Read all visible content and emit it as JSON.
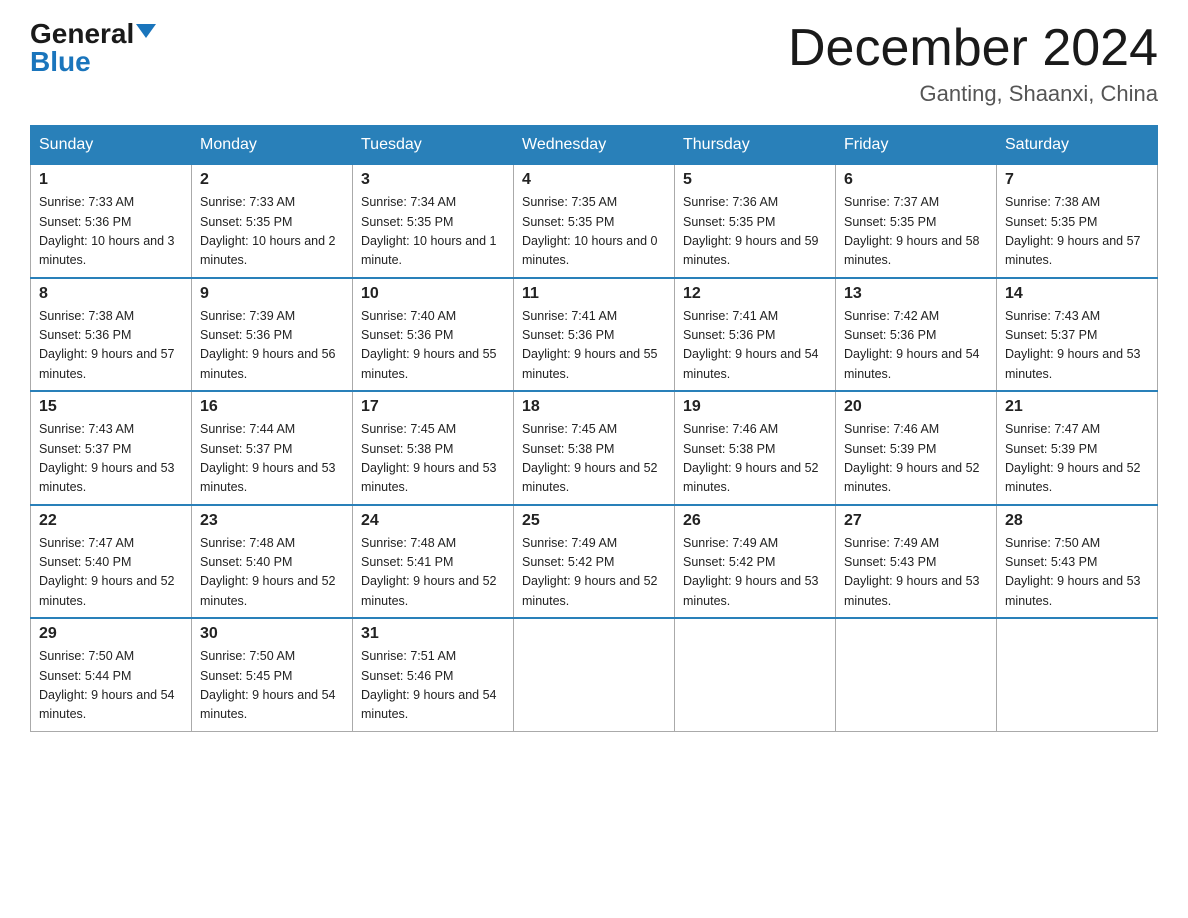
{
  "header": {
    "logo_general": "General",
    "logo_blue": "Blue",
    "month_title": "December 2024",
    "location": "Ganting, Shaanxi, China"
  },
  "days_of_week": [
    "Sunday",
    "Monday",
    "Tuesday",
    "Wednesday",
    "Thursday",
    "Friday",
    "Saturday"
  ],
  "weeks": [
    [
      {
        "day": "1",
        "sunrise": "7:33 AM",
        "sunset": "5:36 PM",
        "daylight": "10 hours and 3 minutes."
      },
      {
        "day": "2",
        "sunrise": "7:33 AM",
        "sunset": "5:35 PM",
        "daylight": "10 hours and 2 minutes."
      },
      {
        "day": "3",
        "sunrise": "7:34 AM",
        "sunset": "5:35 PM",
        "daylight": "10 hours and 1 minute."
      },
      {
        "day": "4",
        "sunrise": "7:35 AM",
        "sunset": "5:35 PM",
        "daylight": "10 hours and 0 minutes."
      },
      {
        "day": "5",
        "sunrise": "7:36 AM",
        "sunset": "5:35 PM",
        "daylight": "9 hours and 59 minutes."
      },
      {
        "day": "6",
        "sunrise": "7:37 AM",
        "sunset": "5:35 PM",
        "daylight": "9 hours and 58 minutes."
      },
      {
        "day": "7",
        "sunrise": "7:38 AM",
        "sunset": "5:35 PM",
        "daylight": "9 hours and 57 minutes."
      }
    ],
    [
      {
        "day": "8",
        "sunrise": "7:38 AM",
        "sunset": "5:36 PM",
        "daylight": "9 hours and 57 minutes."
      },
      {
        "day": "9",
        "sunrise": "7:39 AM",
        "sunset": "5:36 PM",
        "daylight": "9 hours and 56 minutes."
      },
      {
        "day": "10",
        "sunrise": "7:40 AM",
        "sunset": "5:36 PM",
        "daylight": "9 hours and 55 minutes."
      },
      {
        "day": "11",
        "sunrise": "7:41 AM",
        "sunset": "5:36 PM",
        "daylight": "9 hours and 55 minutes."
      },
      {
        "day": "12",
        "sunrise": "7:41 AM",
        "sunset": "5:36 PM",
        "daylight": "9 hours and 54 minutes."
      },
      {
        "day": "13",
        "sunrise": "7:42 AM",
        "sunset": "5:36 PM",
        "daylight": "9 hours and 54 minutes."
      },
      {
        "day": "14",
        "sunrise": "7:43 AM",
        "sunset": "5:37 PM",
        "daylight": "9 hours and 53 minutes."
      }
    ],
    [
      {
        "day": "15",
        "sunrise": "7:43 AM",
        "sunset": "5:37 PM",
        "daylight": "9 hours and 53 minutes."
      },
      {
        "day": "16",
        "sunrise": "7:44 AM",
        "sunset": "5:37 PM",
        "daylight": "9 hours and 53 minutes."
      },
      {
        "day": "17",
        "sunrise": "7:45 AM",
        "sunset": "5:38 PM",
        "daylight": "9 hours and 53 minutes."
      },
      {
        "day": "18",
        "sunrise": "7:45 AM",
        "sunset": "5:38 PM",
        "daylight": "9 hours and 52 minutes."
      },
      {
        "day": "19",
        "sunrise": "7:46 AM",
        "sunset": "5:38 PM",
        "daylight": "9 hours and 52 minutes."
      },
      {
        "day": "20",
        "sunrise": "7:46 AM",
        "sunset": "5:39 PM",
        "daylight": "9 hours and 52 minutes."
      },
      {
        "day": "21",
        "sunrise": "7:47 AM",
        "sunset": "5:39 PM",
        "daylight": "9 hours and 52 minutes."
      }
    ],
    [
      {
        "day": "22",
        "sunrise": "7:47 AM",
        "sunset": "5:40 PM",
        "daylight": "9 hours and 52 minutes."
      },
      {
        "day": "23",
        "sunrise": "7:48 AM",
        "sunset": "5:40 PM",
        "daylight": "9 hours and 52 minutes."
      },
      {
        "day": "24",
        "sunrise": "7:48 AM",
        "sunset": "5:41 PM",
        "daylight": "9 hours and 52 minutes."
      },
      {
        "day": "25",
        "sunrise": "7:49 AM",
        "sunset": "5:42 PM",
        "daylight": "9 hours and 52 minutes."
      },
      {
        "day": "26",
        "sunrise": "7:49 AM",
        "sunset": "5:42 PM",
        "daylight": "9 hours and 53 minutes."
      },
      {
        "day": "27",
        "sunrise": "7:49 AM",
        "sunset": "5:43 PM",
        "daylight": "9 hours and 53 minutes."
      },
      {
        "day": "28",
        "sunrise": "7:50 AM",
        "sunset": "5:43 PM",
        "daylight": "9 hours and 53 minutes."
      }
    ],
    [
      {
        "day": "29",
        "sunrise": "7:50 AM",
        "sunset": "5:44 PM",
        "daylight": "9 hours and 54 minutes."
      },
      {
        "day": "30",
        "sunrise": "7:50 AM",
        "sunset": "5:45 PM",
        "daylight": "9 hours and 54 minutes."
      },
      {
        "day": "31",
        "sunrise": "7:51 AM",
        "sunset": "5:46 PM",
        "daylight": "9 hours and 54 minutes."
      },
      null,
      null,
      null,
      null
    ]
  ]
}
